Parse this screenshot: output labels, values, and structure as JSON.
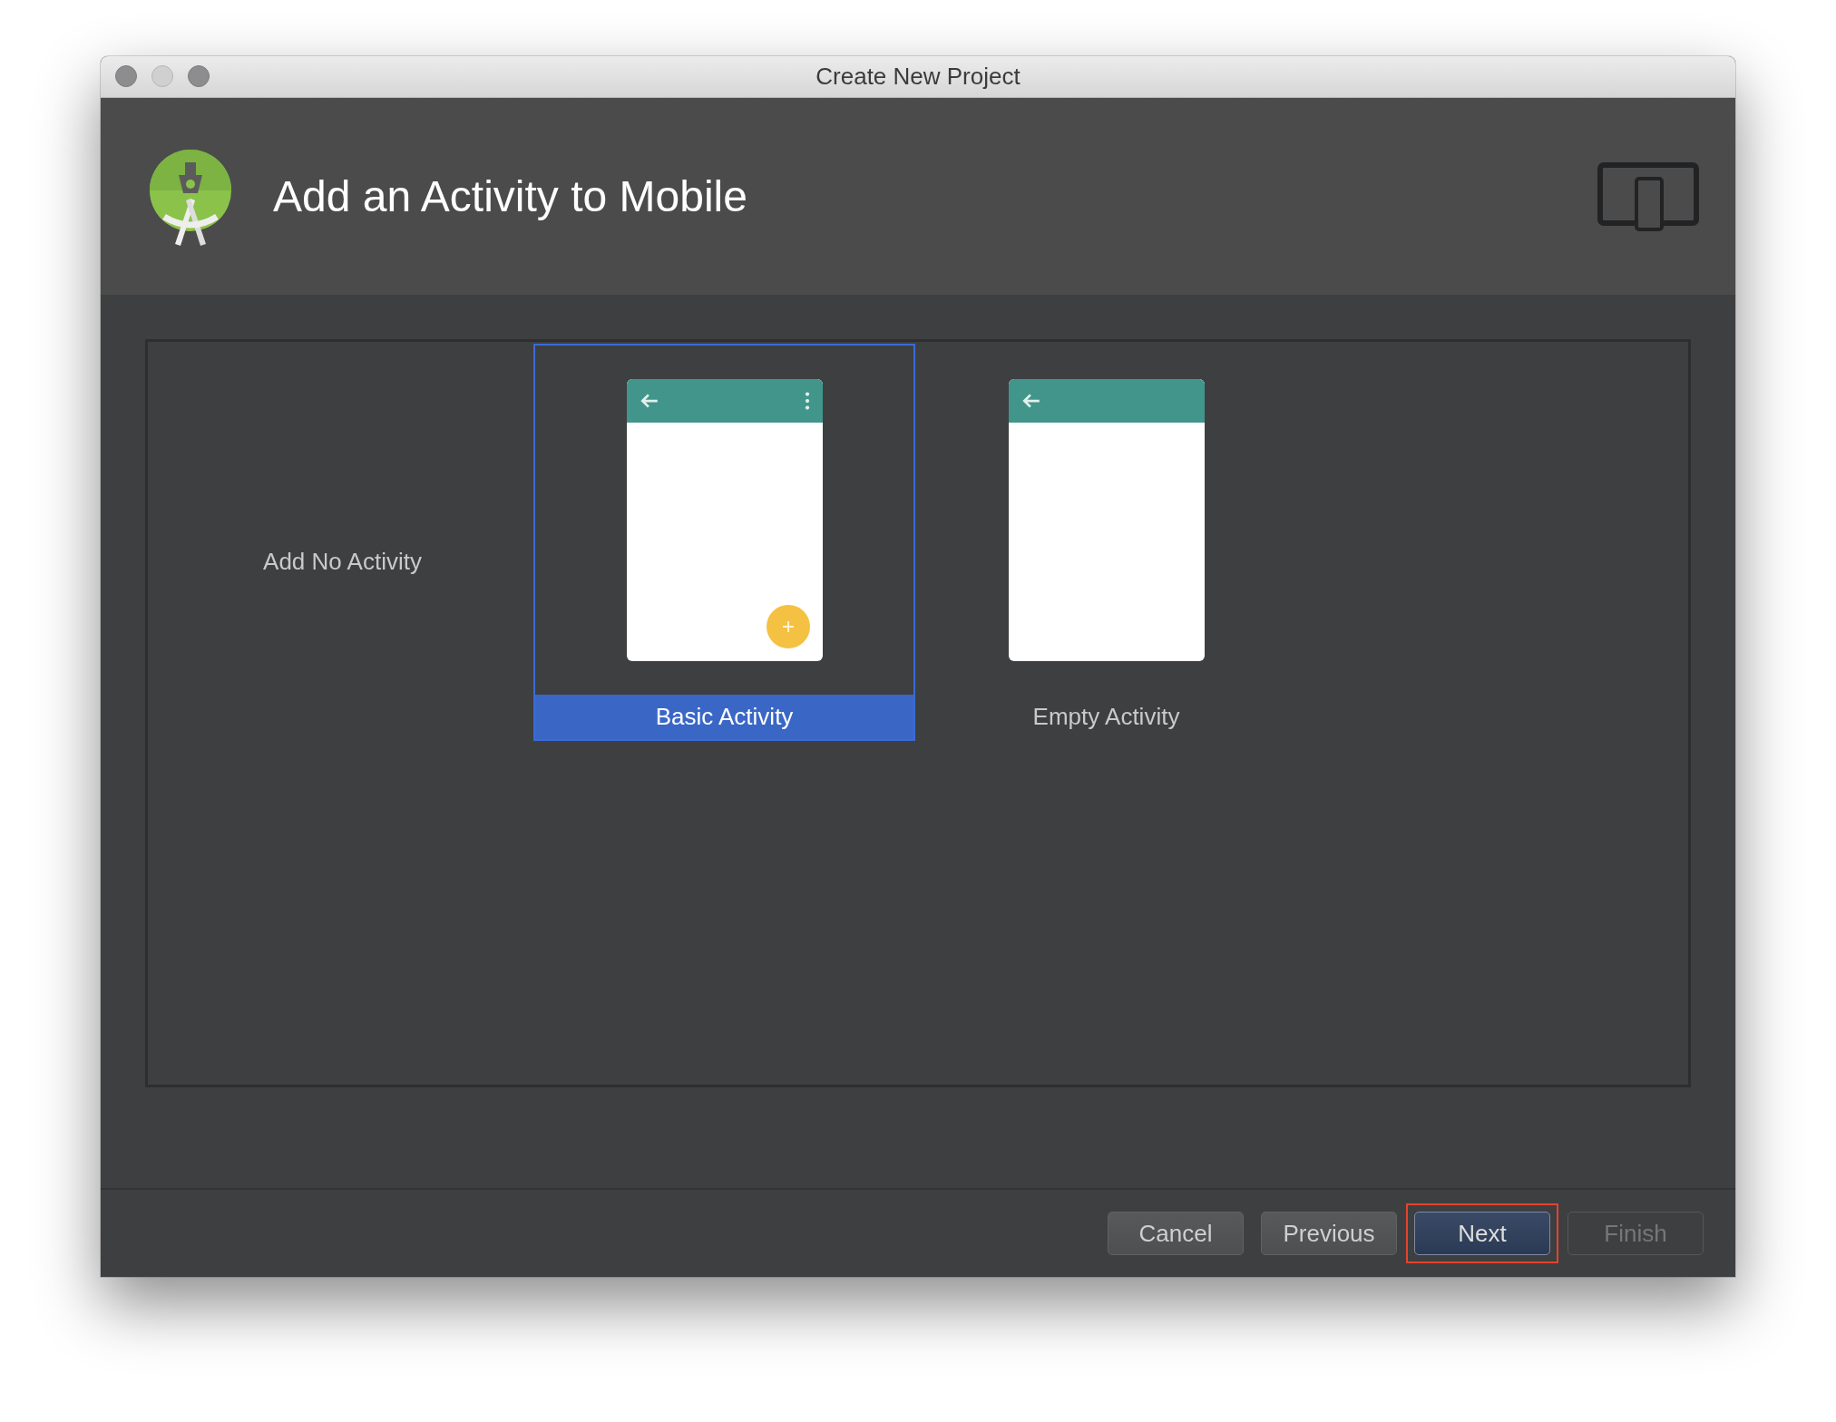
{
  "window": {
    "title": "Create New Project"
  },
  "header": {
    "title": "Add an Activity to Mobile"
  },
  "templates": [
    {
      "label": "Add No Activity",
      "kind": "none",
      "selected": false
    },
    {
      "label": "Basic Activity",
      "kind": "basic",
      "selected": true
    },
    {
      "label": "Empty Activity",
      "kind": "empty",
      "selected": false
    }
  ],
  "buttons": [
    {
      "label": "Cancel",
      "kind": "normal",
      "disabled": false,
      "focused": false
    },
    {
      "label": "Previous",
      "kind": "normal",
      "disabled": false,
      "focused": false
    },
    {
      "label": "Next",
      "kind": "default",
      "disabled": false,
      "focused": true
    },
    {
      "label": "Finish",
      "kind": "normal",
      "disabled": true,
      "focused": false
    }
  ]
}
